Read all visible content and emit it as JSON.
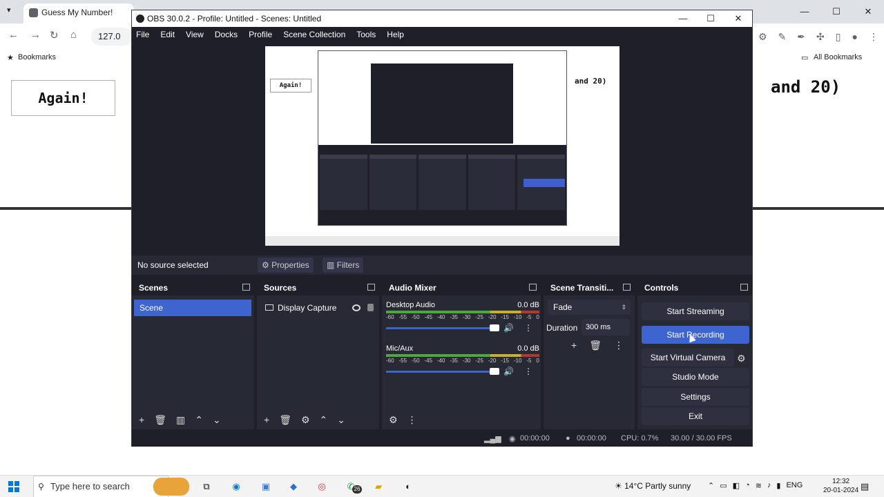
{
  "browser": {
    "tab_title": "Guess My Number!",
    "address": "127.0",
    "bookmarks_label": "Bookmarks",
    "all_bookmarks_label": "All Bookmarks",
    "page_button": "Again!",
    "page_text": "and 20)"
  },
  "obs": {
    "title": "OBS 30.0.2 - Profile: Untitled - Scenes: Untitled",
    "menu": [
      "File",
      "Edit",
      "View",
      "Docks",
      "Profile",
      "Scene Collection",
      "Tools",
      "Help"
    ],
    "preview_again": "Again!",
    "preview_text": "and 20)",
    "source_bar": {
      "no_source": "No source selected",
      "properties": "Properties",
      "filters": "Filters"
    },
    "scenes": {
      "title": "Scenes",
      "items": [
        "Scene"
      ]
    },
    "sources": {
      "title": "Sources",
      "items": [
        "Display Capture"
      ]
    },
    "mixer": {
      "title": "Audio Mixer",
      "scale": [
        "-60",
        "-55",
        "-50",
        "-45",
        "-40",
        "-35",
        "-30",
        "-25",
        "-20",
        "-15",
        "-10",
        "-5",
        "0"
      ],
      "channels": [
        {
          "name": "Desktop Audio",
          "db": "0.0 dB",
          "volume": 1.0
        },
        {
          "name": "Mic/Aux",
          "db": "0.0 dB",
          "volume": 1.0
        }
      ]
    },
    "transitions": {
      "title": "Scene Transiti...",
      "selected": "Fade",
      "duration_label": "Duration",
      "duration_value": "300 ms"
    },
    "controls": {
      "title": "Controls",
      "start_streaming": "Start Streaming",
      "start_recording": "Start Recording",
      "start_virtual_camera": "Start Virtual Camera",
      "studio_mode": "Studio Mode",
      "settings": "Settings",
      "exit": "Exit"
    },
    "status": {
      "stream_time": "00:00:00",
      "rec_time": "00:00:00",
      "cpu": "CPU: 0.7%",
      "fps": "30.00 / 30.00 FPS"
    }
  },
  "taskbar": {
    "search_placeholder": "Type here to search",
    "whatsapp_badge": "26",
    "weather": "14°C  Partly sunny",
    "lang": "ENG",
    "time": "12:32",
    "date": "20-01-2024"
  }
}
